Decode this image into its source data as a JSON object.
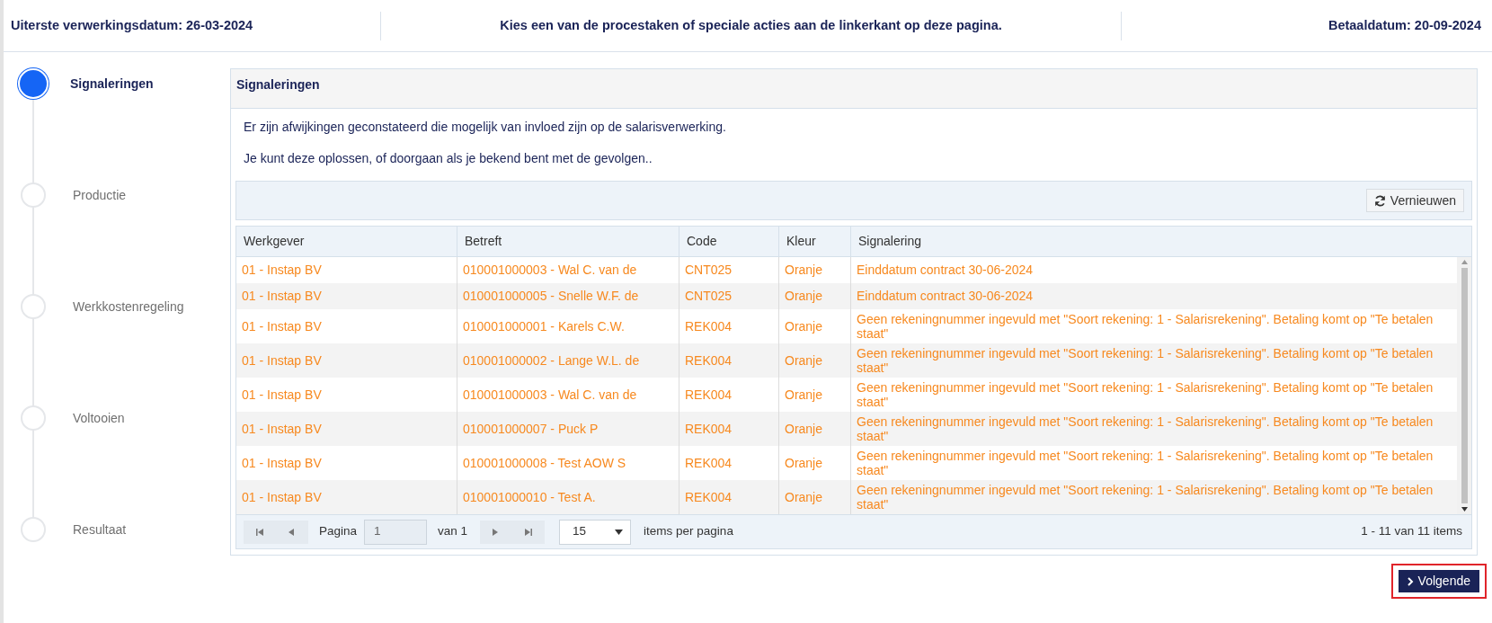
{
  "header": {
    "deadline": "Uiterste verwerkingsdatum: 26-03-2024",
    "instruction": "Kies een van de procestaken of speciale acties aan de linkerkant op deze pagina.",
    "pay_date": "Betaaldatum: 20-09-2024"
  },
  "steps": [
    {
      "label": "Signaleringen",
      "selected": true
    },
    {
      "label": "Productie",
      "selected": false
    },
    {
      "label": "Werkkostenregeling",
      "selected": false
    },
    {
      "label": "Voltooien",
      "selected": false
    },
    {
      "label": "Resultaat",
      "selected": false
    }
  ],
  "panel": {
    "title": "Signaleringen",
    "messages": [
      "Er zijn afwijkingen geconstateerd die mogelijk van invloed zijn op de salarisverwerking.",
      "Je kunt deze oplossen, of doorgaan als je bekend bent met de gevolgen.."
    ],
    "refresh_button": "Vernieuwen"
  },
  "table": {
    "columns": [
      "Werkgever",
      "Betreft",
      "Code",
      "Kleur",
      "Signalering"
    ],
    "rows": [
      [
        "01 - Instap BV",
        "010001000003 - Wal C. van de",
        "CNT025",
        "Oranje",
        "Einddatum contract 30-06-2024"
      ],
      [
        "01 - Instap BV",
        "010001000005 - Snelle W.F. de",
        "CNT025",
        "Oranje",
        "Einddatum contract 30-06-2024"
      ],
      [
        "01 - Instap BV",
        "010001000001 - Karels C.W.",
        "REK004",
        "Oranje",
        "Geen rekeningnummer ingevuld met \"Soort rekening: 1 - Salarisrekening\". Betaling komt op \"Te betalen staat\""
      ],
      [
        "01 - Instap BV",
        "010001000002 - Lange W.L. de",
        "REK004",
        "Oranje",
        "Geen rekeningnummer ingevuld met \"Soort rekening: 1 - Salarisrekening\". Betaling komt op \"Te betalen staat\""
      ],
      [
        "01 - Instap BV",
        "010001000003 - Wal C. van de",
        "REK004",
        "Oranje",
        "Geen rekeningnummer ingevuld met \"Soort rekening: 1 - Salarisrekening\". Betaling komt op \"Te betalen staat\""
      ],
      [
        "01 - Instap BV",
        "010001000007 - Puck P",
        "REK004",
        "Oranje",
        "Geen rekeningnummer ingevuld met \"Soort rekening: 1 - Salarisrekening\". Betaling komt op \"Te betalen staat\""
      ],
      [
        "01 - Instap BV",
        "010001000008 - Test AOW S",
        "REK004",
        "Oranje",
        "Geen rekeningnummer ingevuld met \"Soort rekening: 1 - Salarisrekening\". Betaling komt op \"Te betalen staat\""
      ],
      [
        "01 - Instap BV",
        "010001000010 - Test A.",
        "REK004",
        "Oranje",
        "Geen rekeningnummer ingevuld met \"Soort rekening: 1 - Salarisrekening\". Betaling komt op \"Te betalen staat\""
      ]
    ]
  },
  "pager": {
    "page_label": "Pagina",
    "page": "1",
    "of_label": "van 1",
    "page_size": "15",
    "size_label": "items per pagina",
    "summary": "1 - 11 van 11 items"
  },
  "next_button": {
    "label": "Volgende",
    "highlighted": true
  }
}
